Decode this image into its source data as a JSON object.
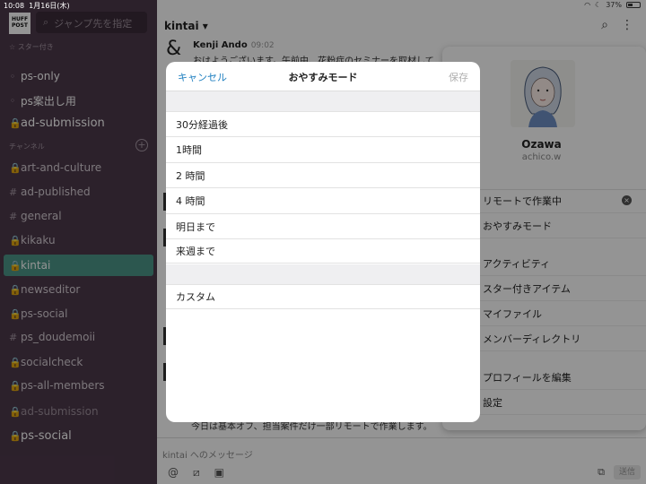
{
  "status_bar": {
    "time": "10:08",
    "date": "1月16日(木)",
    "battery": "37%"
  },
  "sidebar": {
    "brand": "HUFF POST",
    "jump_placeholder": "ジャンプ先を指定",
    "starred_label": "☆ スター付き",
    "channels_label": "チャンネル",
    "starred": [
      {
        "prefix": "◦",
        "label": "ps-only"
      },
      {
        "prefix": "◦",
        "label": "ps案出し用"
      },
      {
        "prefix": "🔒",
        "label": "ad-submission"
      }
    ],
    "channels": [
      {
        "prefix": "🔒",
        "label": "art-and-culture"
      },
      {
        "prefix": "#",
        "label": "ad-published"
      },
      {
        "prefix": "#",
        "label": "general"
      },
      {
        "prefix": "🔒",
        "label": "kikaku"
      },
      {
        "prefix": "🔒",
        "label": "kintai"
      },
      {
        "prefix": "🔒",
        "label": "newseditor"
      },
      {
        "prefix": "🔒",
        "label": "ps-social"
      },
      {
        "prefix": "#",
        "label": "ps_doudemoii"
      },
      {
        "prefix": "🔒",
        "label": "socialcheck"
      },
      {
        "prefix": "🔒",
        "label": "ps-all-members"
      },
      {
        "prefix": "🔒",
        "label": "ad-submission"
      },
      {
        "prefix": "🔒",
        "label": "ps-social"
      }
    ]
  },
  "channel_header": {
    "name": "kintai ▾"
  },
  "message": {
    "author": "Kenji Ando",
    "time": "09:02",
    "text": "おはようございます。午前中、花粉症のセミナーを取材して",
    "bottom_text": "今日は基本オフ、担当案件だけ一部リモートで作業します。"
  },
  "composer": {
    "placeholder": "kintai へのメッセージ",
    "send": "送信"
  },
  "profile_panel": {
    "name": "Ozawa",
    "username": "achico.w",
    "items": [
      {
        "label": "リモートで作業中",
        "clearable": true
      },
      {
        "label": "おやすみモード"
      },
      {
        "label": "アクティビティ"
      },
      {
        "label": "スター付きアイテム"
      },
      {
        "label": "マイファイル"
      },
      {
        "label": "メンバーディレクトリ"
      },
      {
        "label": "プロフィールを編集"
      },
      {
        "label": "設定"
      }
    ]
  },
  "dnd_modal": {
    "cancel": "キャンセル",
    "title": "おやすみモード",
    "save": "保存",
    "options": [
      "30分経過後",
      "1時間",
      "2 時間",
      "4 時間",
      "明日まで",
      "来週まで"
    ],
    "custom": "カスタム"
  }
}
